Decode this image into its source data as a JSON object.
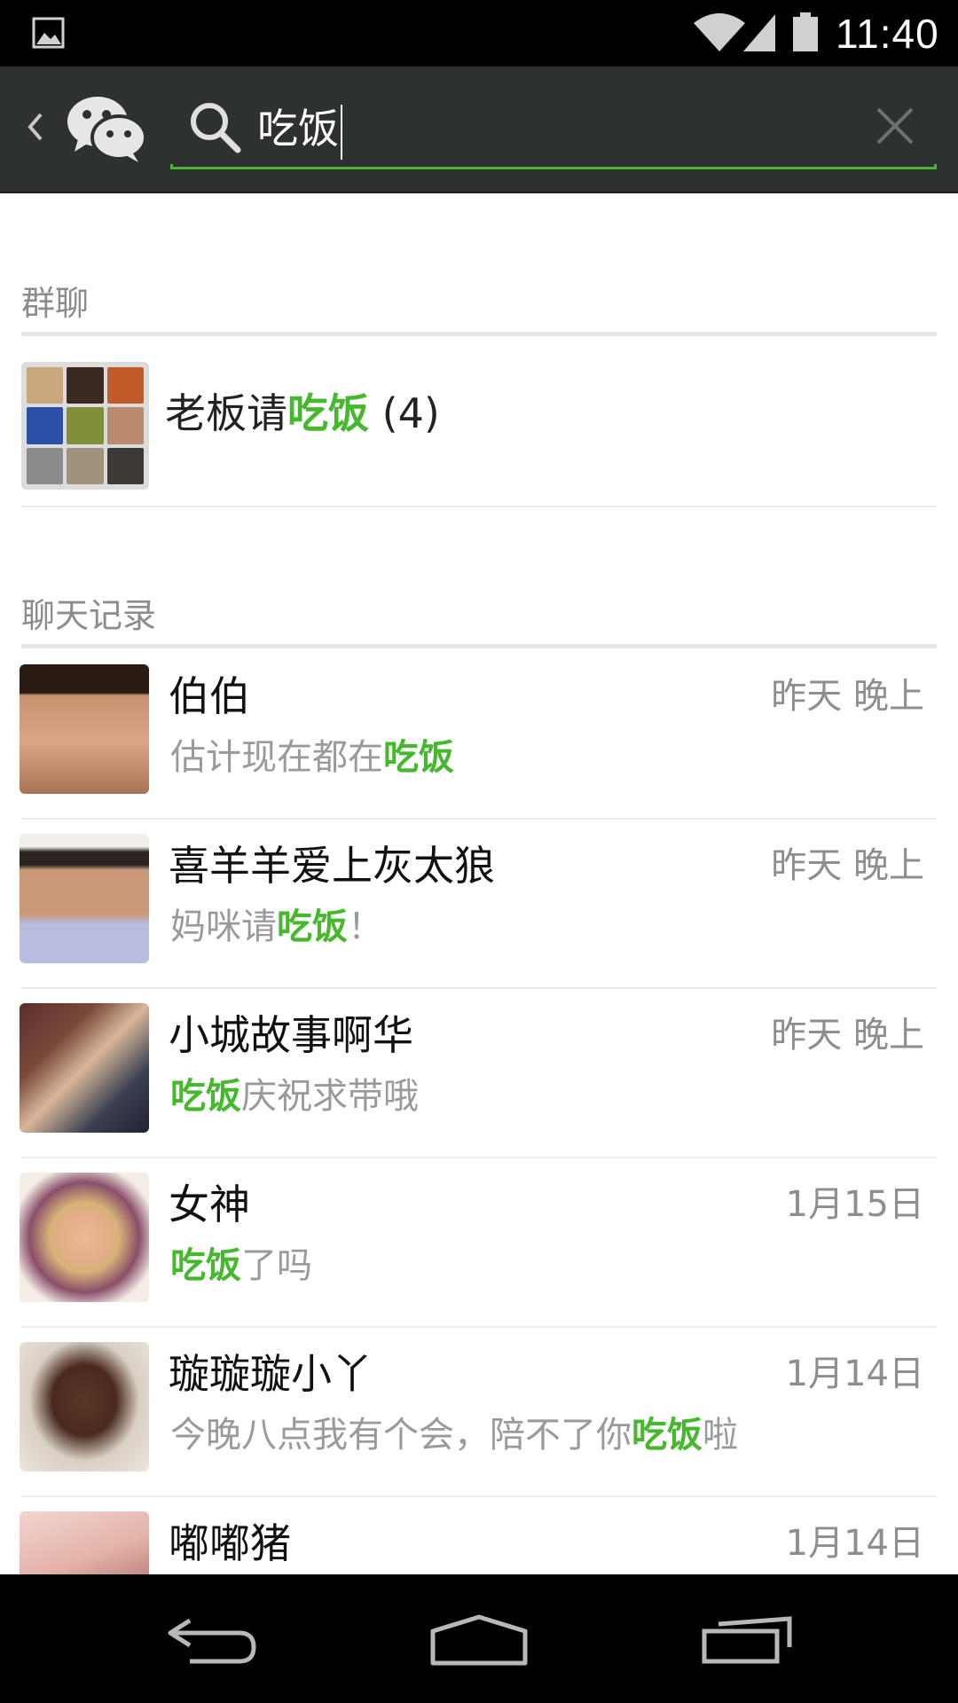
{
  "status_bar": {
    "time": "11:40"
  },
  "header": {
    "query": "吃饭"
  },
  "sections": {
    "group_chats": "群聊",
    "chat_history": "聊天记录"
  },
  "group": {
    "name_prefix": "老板请",
    "name_highlight": "吃饭",
    "name_suffix": " (4)"
  },
  "chats": [
    {
      "name": "伯伯",
      "time": "昨天 晚上",
      "msg_before": "估计现在都在",
      "msg_highlight": "吃饭",
      "msg_after": ""
    },
    {
      "name": "喜羊羊爱上灰太狼",
      "time": "昨天 晚上",
      "msg_before": "妈咪请",
      "msg_highlight": "吃饭",
      "msg_after": "！"
    },
    {
      "name": "小城故事啊华",
      "time": "昨天 晚上",
      "msg_before": "",
      "msg_highlight": "吃饭",
      "msg_after": "庆祝求带哦"
    },
    {
      "name": "女神",
      "time": "1月15日",
      "msg_before": "",
      "msg_highlight": "吃饭",
      "msg_after": "了吗"
    },
    {
      "name": "璇璇璇小丫",
      "time": "1月14日",
      "msg_before": "今晚八点我有个会，陪不了你",
      "msg_highlight": "吃饭",
      "msg_after": "啦"
    },
    {
      "name": "嘟嘟猪",
      "time": "1月14日",
      "msg_before": "",
      "msg_highlight": "",
      "msg_after": ""
    }
  ],
  "colors": {
    "accent": "#45b82e",
    "header_bg": "#2e3132",
    "status_bar_bg": "#000000",
    "secondary_text": "#9a9a9a"
  },
  "icons": [
    "image-icon",
    "wifi-icon",
    "signal-icon",
    "battery-icon",
    "back-chevron-icon",
    "wechat-logo-icon",
    "search-icon",
    "clear-icon",
    "back-nav-icon",
    "home-nav-icon",
    "recents-nav-icon"
  ]
}
